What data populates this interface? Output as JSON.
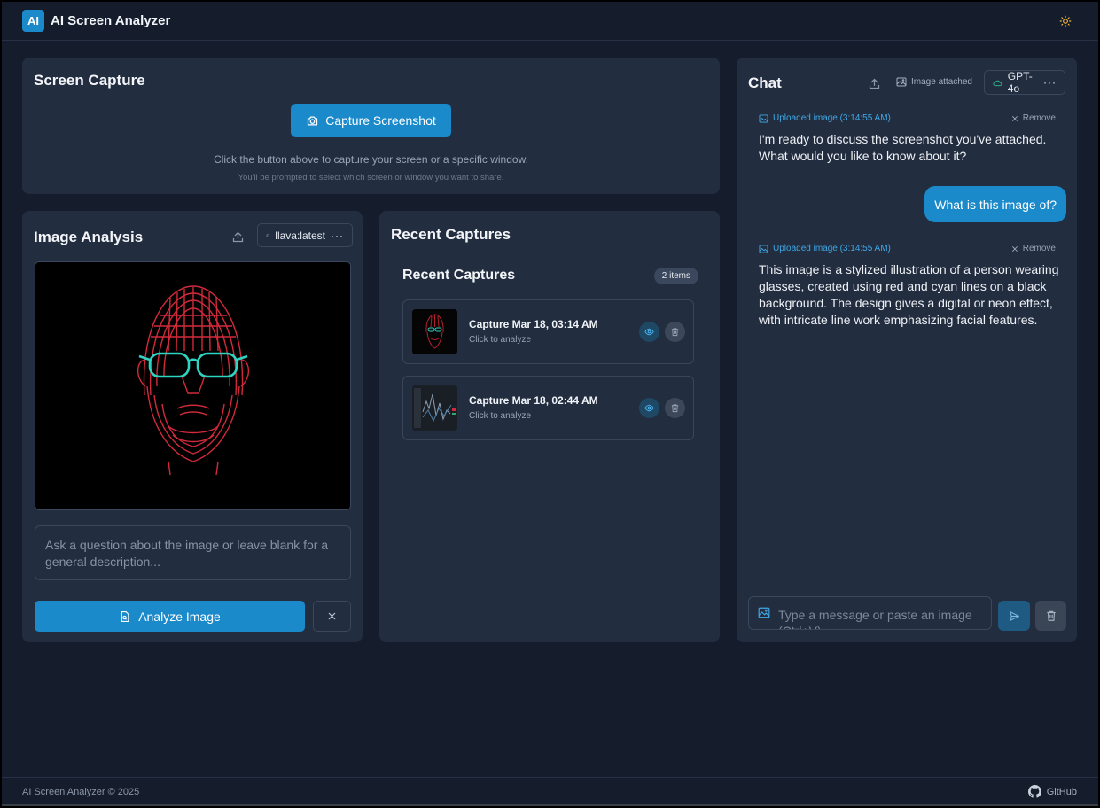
{
  "app": {
    "logo_text": "AI",
    "title": "AI Screen Analyzer"
  },
  "capture": {
    "title": "Screen Capture",
    "button_label": "Capture Screenshot",
    "hint": "Click the button above to capture your screen or a specific window.",
    "subhint": "You'll be prompted to select which screen or window you want to share."
  },
  "analysis": {
    "title": "Image Analysis",
    "model": "llava:latest",
    "question_placeholder": "Ask a question about the image or leave blank for a general description...",
    "analyze_label": "Analyze Image"
  },
  "recent": {
    "title": "Recent Captures",
    "inner_title": "Recent Captures",
    "count": "2 items",
    "items": [
      {
        "title": "Capture Mar 18, 03:14 AM",
        "subtitle": "Click to analyze"
      },
      {
        "title": "Capture Mar 18, 02:44 AM",
        "subtitle": "Click to analyze"
      }
    ]
  },
  "chat": {
    "title": "Chat",
    "attached_label": "Image attached",
    "model": "GPT-4o",
    "messages": [
      {
        "meta": "Uploaded image (3:14:55 AM)",
        "remove": "Remove",
        "text": "I'm ready to discuss the screenshot you've attached. What would you like to know about it?"
      },
      {
        "user_text": "What is this image of?"
      },
      {
        "meta": "Uploaded image (3:14:55 AM)",
        "remove": "Remove",
        "text": "This image is a stylized illustration of a person wearing glasses, created using red and cyan lines on a black background. The design gives a digital or neon effect, with intricate line work emphasizing facial features."
      }
    ],
    "input_placeholder": "Type a message or paste an image (Ctrl+V)"
  },
  "footer": {
    "copyright": "AI Screen Analyzer © 2025",
    "github": "GitHub"
  },
  "colors": {
    "accent": "#1a8acb",
    "background": "#151d2c",
    "card": "#222d3f",
    "link": "#3fa9e8"
  }
}
